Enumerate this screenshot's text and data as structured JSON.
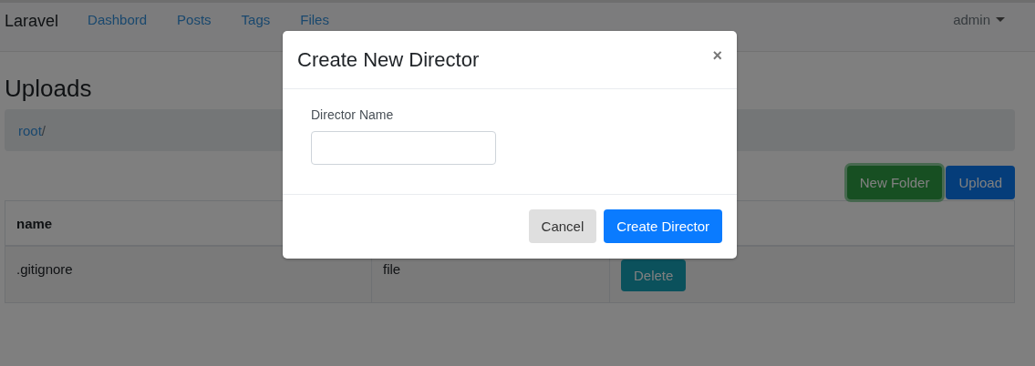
{
  "navbar": {
    "brand": "Laravel",
    "links": [
      {
        "label": "Dashbord"
      },
      {
        "label": "Posts"
      },
      {
        "label": "Tags"
      },
      {
        "label": "Files"
      }
    ],
    "user_menu": "admin"
  },
  "page_title": "Uploads",
  "breadcrumb": [
    {
      "label": "root",
      "kind": "link"
    },
    {
      "label": "/",
      "kind": "separator"
    }
  ],
  "actions": [
    {
      "label": "New Folder",
      "kind": "success",
      "focused": true
    },
    {
      "label": "Upload",
      "kind": "primary",
      "focused": false
    }
  ],
  "table": {
    "columns": [
      "name"
    ],
    "rows": [
      {
        "cells": [
          ".gitignore",
          "file"
        ],
        "action": "Delete"
      }
    ]
  },
  "modal": {
    "title": "Create New Director",
    "close": "×",
    "field": {
      "label": "Director Name"
    },
    "buttons": [
      {
        "label": "Cancel",
        "kind": "secondary"
      },
      {
        "label": "Create Director",
        "kind": "primary"
      }
    ]
  }
}
